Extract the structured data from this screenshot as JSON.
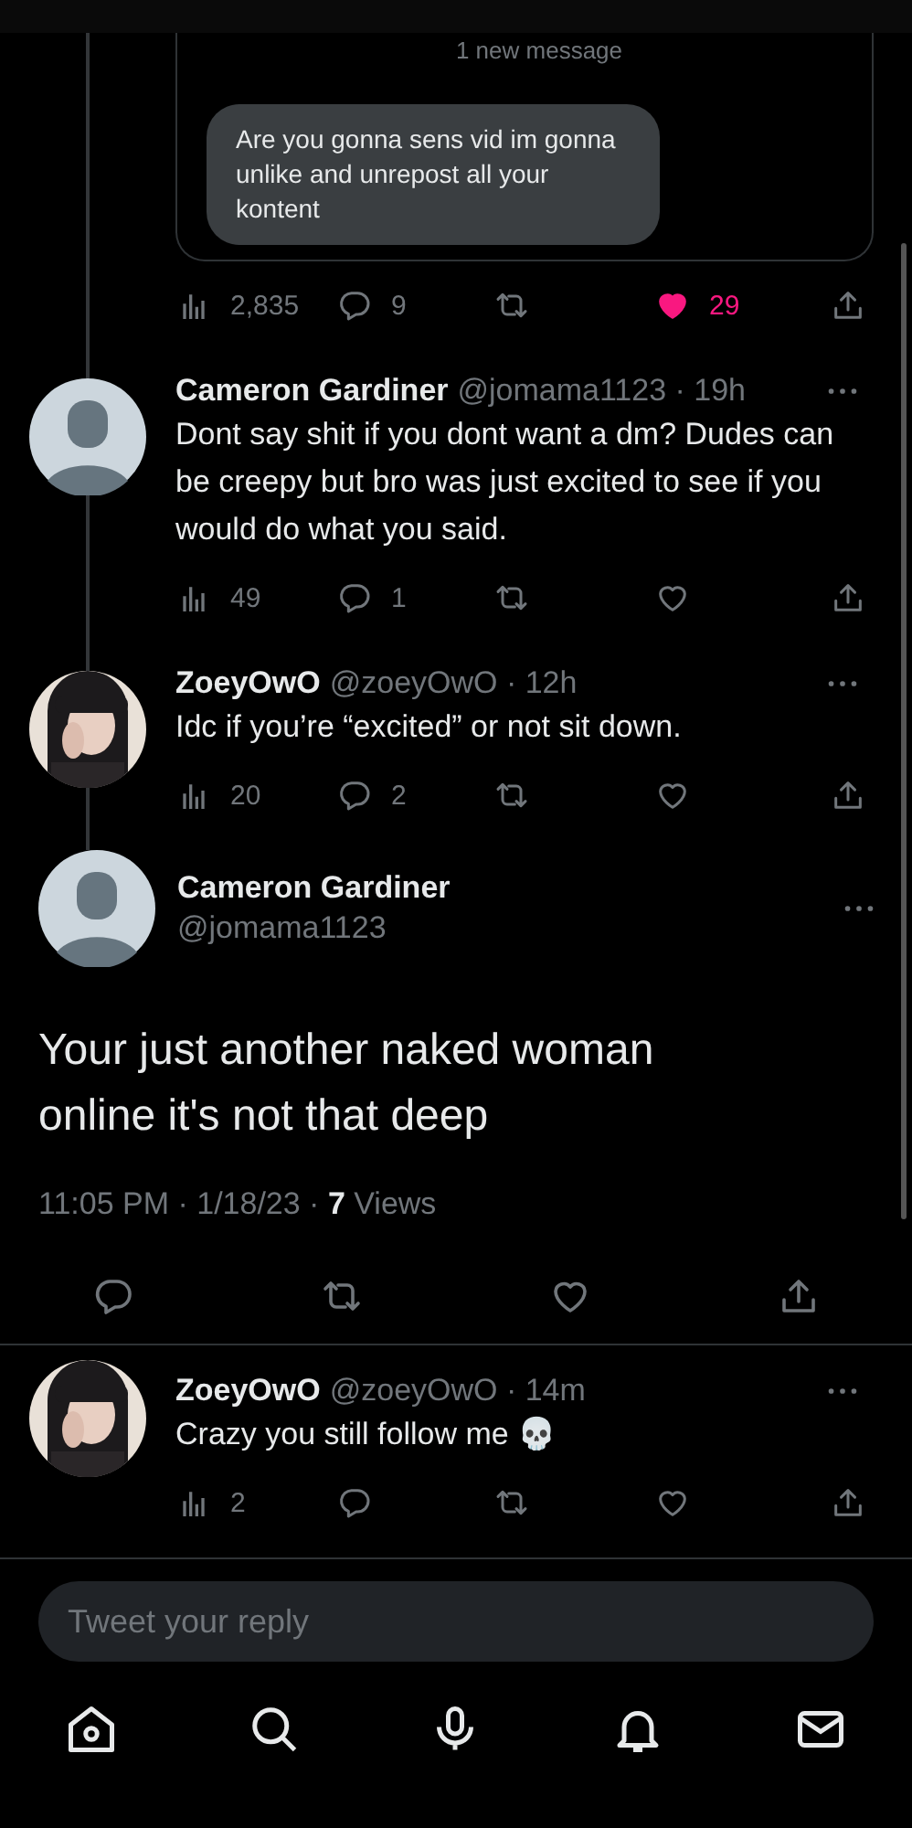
{
  "quoted_message": {
    "divider_label": "1 new message",
    "bubble": "Are you gonna sens vid im gonna unlike and unrepost all your kontent"
  },
  "quote_actions": {
    "views": "2,835",
    "replies": "9",
    "likes": "29",
    "liked": true
  },
  "replies": [
    {
      "avatar": {
        "kind": "default"
      },
      "name": "Cameron Gardiner",
      "meta": "@jomama1123 · 19h",
      "text": "Dont say shit if you dont want a dm? Dudes can be creepy but bro was just excited to see if you would do what you said.",
      "views": "49",
      "replies": "1",
      "liked": false
    },
    {
      "name": "ZoeyOwO",
      "meta": "@zoeyOwO · 12h",
      "text": "Idc if you’re “excited” or not sit down.",
      "views": "20",
      "replies": "2",
      "liked": false
    }
  ],
  "main_tweet": {
    "avatar": {
      "kind": "default"
    },
    "name": "Cameron Gardiner",
    "handle": "@jomama1123",
    "text": "Your just another naked woman online it's not that deep",
    "timestamp": "11:05 PM · 1/18/23 · ",
    "views_count": "7",
    "views_label": "Views",
    "liked": false
  },
  "latest_reply": {
    "name": "ZoeyOwO",
    "meta": "@zoeyOwO · 14m",
    "text": "Crazy you still follow me 💀",
    "views": "2",
    "liked": false
  },
  "reply_field": {
    "placeholder": "Tweet your reply"
  }
}
